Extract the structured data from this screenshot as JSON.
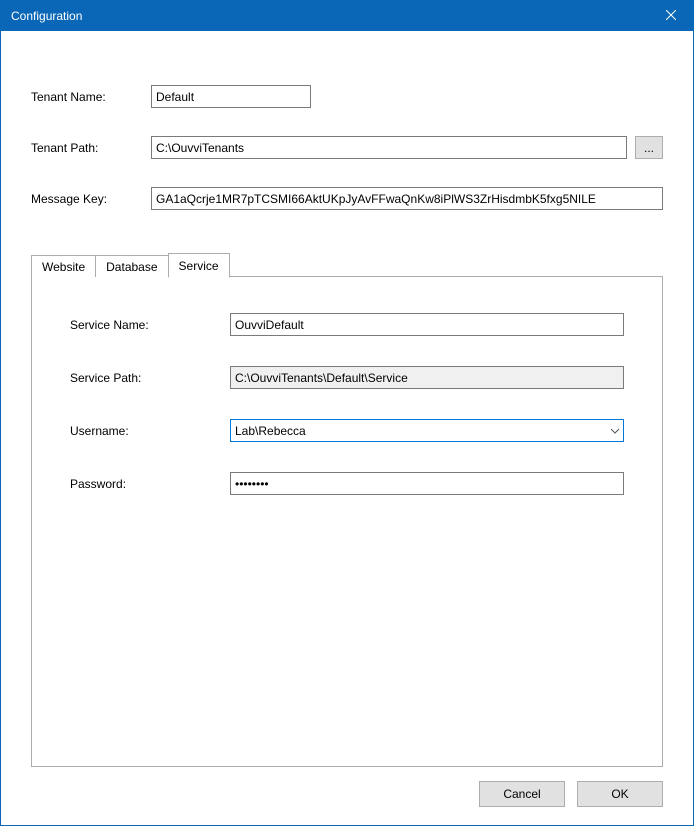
{
  "window": {
    "title": "Configuration"
  },
  "form": {
    "tenant_name_label": "Tenant Name:",
    "tenant_name_value": "Default",
    "tenant_path_label": "Tenant Path:",
    "tenant_path_value": "C:\\OuvviTenants",
    "browse_label": "...",
    "message_key_label": "Message Key:",
    "message_key_value": "GA1aQcrje1MR7pTCSMI66AktUKpJyAvFFwaQnKw8iPlWS3ZrHisdmbK5fxg5NILE"
  },
  "tabs": [
    {
      "label": "Website"
    },
    {
      "label": "Database"
    },
    {
      "label": "Service"
    }
  ],
  "service_tab": {
    "service_name_label": "Service Name:",
    "service_name_value": "OuvviDefault",
    "service_path_label": "Service Path:",
    "service_path_value": "C:\\OuvviTenants\\Default\\Service",
    "username_label": "Username:",
    "username_value": "Lab\\Rebecca",
    "password_label": "Password:",
    "password_value": "••••••••"
  },
  "buttons": {
    "cancel": "Cancel",
    "ok": "OK"
  }
}
